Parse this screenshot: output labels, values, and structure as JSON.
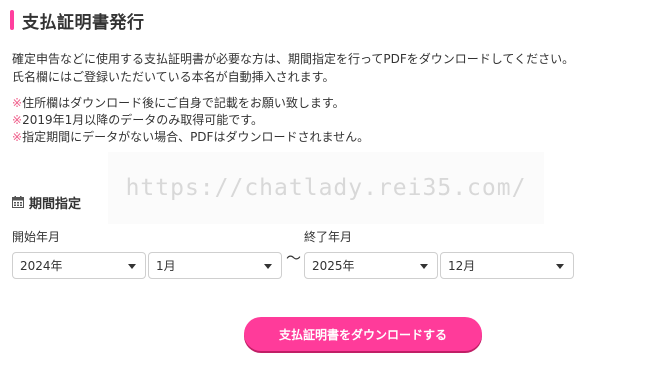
{
  "colors": {
    "accent": "#ff3f9e",
    "button_bg": "#ff3b9a",
    "note_mark": "#f0608c"
  },
  "title": "支払証明書発行",
  "description": {
    "line1": "確定申告などに使用する支払証明書が必要な方は、期間指定を行ってPDFをダウンロードしてください。",
    "line2": "氏名欄にはご登録いただいている本名が自動挿入されます。"
  },
  "notes": [
    {
      "mark": "※",
      "text": "住所欄はダウンロード後にご自身で記載をお願い致します。"
    },
    {
      "mark": "※",
      "text": "2019年1月以降のデータのみ取得可能です。"
    },
    {
      "mark": "※",
      "text": "指定期間にデータがない場合、PDFはダウンロードされません。"
    }
  ],
  "watermark": "https://chatlady.rei35.com/",
  "period": {
    "heading": "期間指定",
    "icon": "calendar-icon",
    "start_label": "開始年月",
    "end_label": "終了年月",
    "separator": "〜",
    "start_year": "2024年",
    "start_month": "1月",
    "end_year": "2025年",
    "end_month": "12月"
  },
  "download_button": "支払証明書をダウンロードする"
}
